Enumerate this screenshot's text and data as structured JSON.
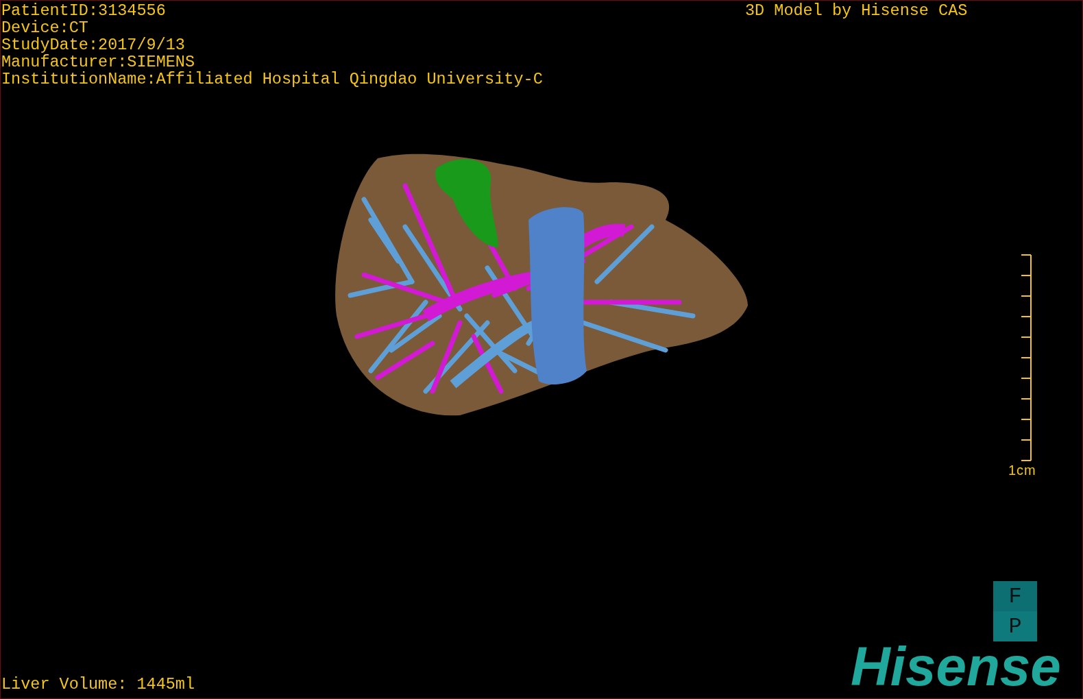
{
  "info_lines": [
    "PatientID:3134556",
    "Device:CT",
    "StudyDate:2017/9/13",
    "Manufacturer:SIEMENS",
    "InstitutionName:Affiliated Hospital Qingdao University-C"
  ],
  "header_right": "3D Model by Hisense CAS",
  "scale_bar": {
    "label": "1cm"
  },
  "view_buttons": [
    "F",
    "P"
  ],
  "logo": "Hisense",
  "liver_volume": "Liver Volume: 1445ml"
}
